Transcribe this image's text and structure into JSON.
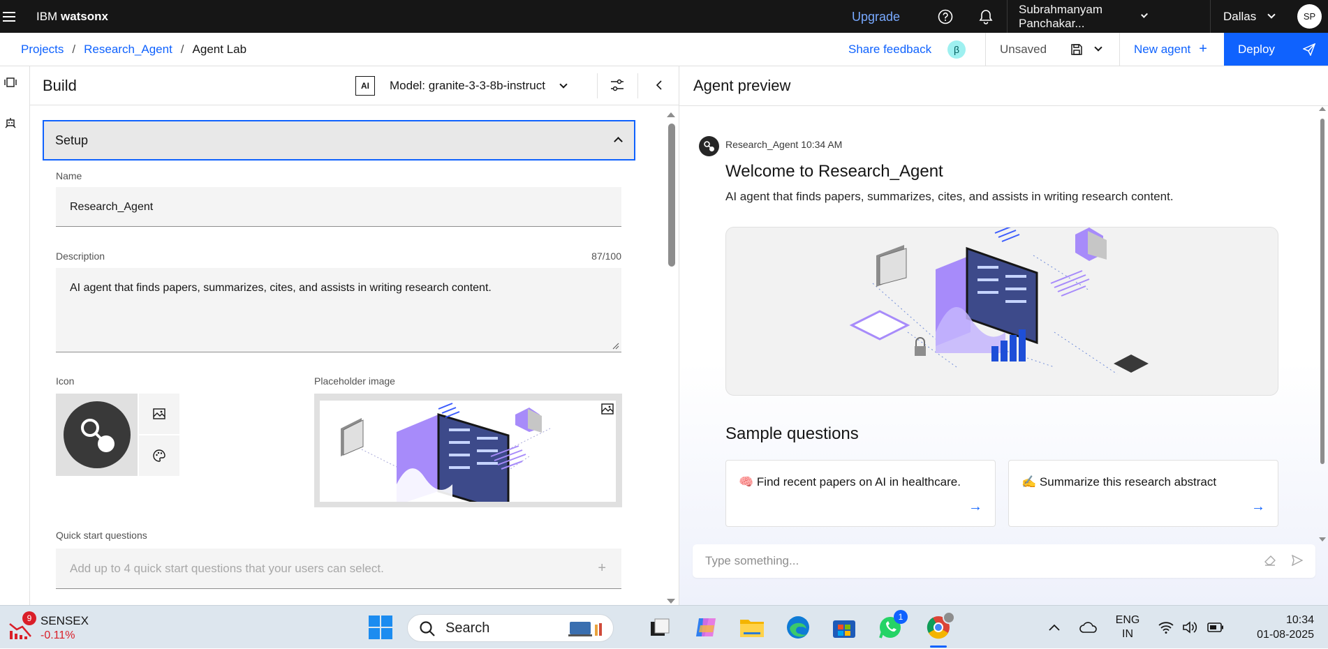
{
  "topbar": {
    "brand_ibm": "IBM",
    "brand_product": "watsonx",
    "upgrade_label": "Upgrade",
    "user_name": "Subrahmanyam Panchakar...",
    "region": "Dallas",
    "avatar_initials": "SP"
  },
  "breadcrumb": {
    "items": [
      "Projects",
      "Research_Agent",
      "Agent Lab"
    ],
    "separator": "/"
  },
  "actions": {
    "share_feedback": "Share feedback",
    "beta_badge": "β",
    "status": "Unsaved",
    "new_agent": "New agent",
    "new_agent_plus": "+",
    "deploy": "Deploy"
  },
  "build": {
    "title": "Build",
    "ai_badge": "AI",
    "model_label": "Model: granite-3-3-8b-instruct",
    "setup_label": "Setup",
    "name_label": "Name",
    "name_value": "Research_Agent",
    "description_label": "Description",
    "description_counter": "87/100",
    "description_value": "AI agent that finds papers, summarizes, cites, and assists in writing research content.",
    "icon_label": "Icon",
    "placeholder_image_label": "Placeholder image",
    "quick_start_label": "Quick start questions",
    "quick_start_placeholder": "Add up to 4 quick start questions that your users can select.",
    "quick_start_add": "+"
  },
  "preview": {
    "title": "Agent preview",
    "agent_name": "Research_Agent",
    "time": "10:34 AM",
    "welcome_title": "Welcome to Research_Agent",
    "welcome_desc": "AI agent that finds papers, summarizes, cites, and assists in writing research content.",
    "sample_title": "Sample questions",
    "samples": [
      {
        "emoji": "🧠",
        "text": "Find recent papers on AI in healthcare."
      },
      {
        "emoji": "✍️",
        "text": "Summarize this research abstract"
      }
    ],
    "input_placeholder": "Type something..."
  },
  "taskbar": {
    "sensex_badge": "9",
    "sensex_label": "SENSEX",
    "sensex_change": "-0.11%",
    "search_label": "Search",
    "whatsapp_badge": "1",
    "lang_top": "ENG",
    "lang_bottom": "IN",
    "time": "10:34",
    "date": "01-08-2025"
  },
  "colors": {
    "accent": "#0f62fe",
    "topbar_bg": "#161616",
    "link_topbar": "#78a9ff",
    "sensex_negative": "#da1e28",
    "taskbar_bg": "#dde6ee"
  }
}
